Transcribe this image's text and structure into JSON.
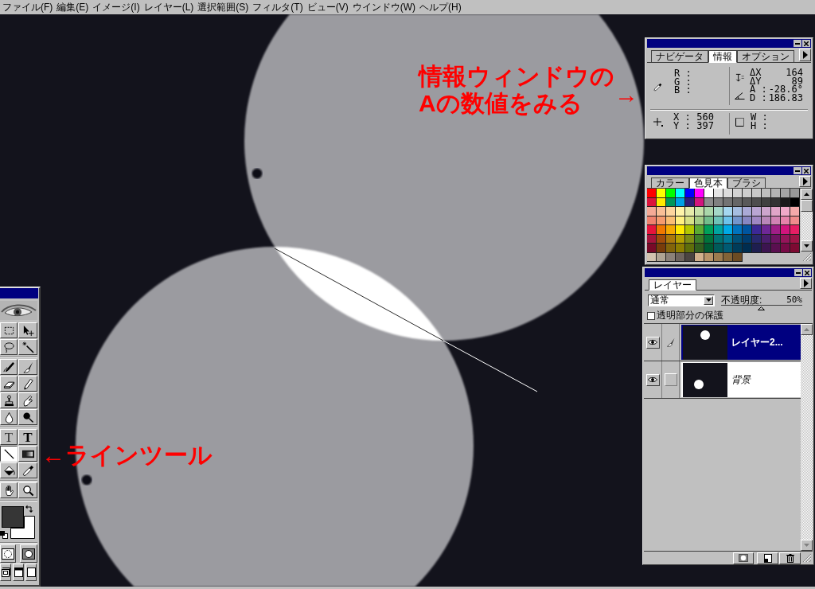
{
  "menu_bar": {
    "items": [
      "ファイル(F)",
      "編集(E)",
      "イメージ(I)",
      "レイヤー(L)",
      "選択範囲(S)",
      "フィルタ(T)",
      "ビュー(V)",
      "ウインドウ(W)",
      "ヘルプ(H)"
    ]
  },
  "canvas": {
    "callouts": [
      {
        "kind": "info",
        "lines": [
          "情報ウィンドウの",
          "Aの数値をみる"
        ],
        "arrow": "→"
      },
      {
        "kind": "tool",
        "lines": [
          "←ラインツール"
        ]
      }
    ]
  },
  "toolbox": {
    "tool_groups": [
      {
        "tools": [
          {
            "kind": "marquee",
            "selected": false
          },
          {
            "kind": "move",
            "selected": false
          },
          {
            "kind": "lasso",
            "selected": false
          },
          {
            "kind": "magic_wand",
            "selected": false
          }
        ]
      },
      {
        "tools": [
          {
            "kind": "airbrush",
            "selected": false
          },
          {
            "kind": "paintbrush",
            "selected": false
          },
          {
            "kind": "eraser",
            "selected": false
          },
          {
            "kind": "pencil",
            "selected": false
          },
          {
            "kind": "rubber_stamp",
            "selected": false
          },
          {
            "kind": "smudge",
            "selected": false
          },
          {
            "kind": "blur",
            "selected": false
          },
          {
            "kind": "dodge",
            "selected": false
          }
        ]
      },
      {
        "tools": [
          {
            "kind": "type_mask",
            "glyph": "T",
            "selected": false
          },
          {
            "kind": "type",
            "glyph": "T",
            "selected": false
          },
          {
            "kind": "line",
            "selected": true
          },
          {
            "kind": "gradient",
            "selected": false
          },
          {
            "kind": "paint_bucket",
            "selected": false
          },
          {
            "kind": "eyedropper",
            "selected": false
          }
        ]
      },
      {
        "tools": [
          {
            "kind": "hand",
            "selected": false
          },
          {
            "kind": "zoom",
            "selected": false
          }
        ]
      }
    ],
    "colors": [
      {
        "kind": "foreground",
        "color": "#363636"
      },
      {
        "kind": "background",
        "color": "#ffffff"
      }
    ]
  },
  "info_panel": {
    "tabs": [
      {
        "label": "ナビゲータ",
        "selected": false
      },
      {
        "label": "情報",
        "selected": true
      },
      {
        "label": "オプション",
        "selected": false
      }
    ],
    "color_readout": [
      "R :",
      "G :",
      "B :"
    ],
    "measure_readout": [
      {
        "label": "ΔX",
        "value": "164"
      },
      {
        "label": "ΔY",
        "value": "89"
      },
      {
        "label": "A :",
        "value": "-28.6°"
      },
      {
        "label": "D :",
        "value": "186.83"
      }
    ],
    "position_readout": [
      {
        "label": "X :",
        "value": "560"
      },
      {
        "label": "Y :",
        "value": "397"
      }
    ],
    "size_readout": [
      "W :",
      "H :"
    ]
  },
  "swatches_panel": {
    "tabs": [
      {
        "label": "カラー",
        "selected": false
      },
      {
        "label": "色見本",
        "selected": true
      },
      {
        "label": "ブラシ",
        "selected": false
      }
    ],
    "swatches": [
      {
        "color": "#ff0000"
      },
      {
        "color": "#ffff00"
      },
      {
        "color": "#00ff00"
      },
      {
        "color": "#00ffff"
      },
      {
        "color": "#0000ff"
      },
      {
        "color": "#ff00ff"
      },
      {
        "color": "#ffffff"
      },
      {
        "color": "#e6e6e6"
      },
      {
        "color": "#dcdcdc"
      },
      {
        "color": "#d2d2d2"
      },
      {
        "color": "#cdcdcd"
      },
      {
        "color": "#c8c8c8"
      },
      {
        "color": "#bebebe"
      },
      {
        "color": "#b4b4b4"
      },
      {
        "color": "#a5a5a5"
      },
      {
        "color": "#999999"
      },
      {
        "color": "#dc143c"
      },
      {
        "color": "#ffea00"
      },
      {
        "color": "#00965a"
      },
      {
        "color": "#00a0e6"
      },
      {
        "color": "#2d1e78"
      },
      {
        "color": "#d2147d"
      },
      {
        "color": "#8c8c8c"
      },
      {
        "color": "#808080"
      },
      {
        "color": "#737373"
      },
      {
        "color": "#666666"
      },
      {
        "color": "#595959"
      },
      {
        "color": "#4d4d4d"
      },
      {
        "color": "#404040"
      },
      {
        "color": "#333333"
      },
      {
        "color": "#1a1a1a"
      },
      {
        "color": "#000000"
      },
      {
        "color": "#f5aa96"
      },
      {
        "color": "#f9bf96"
      },
      {
        "color": "#fdd59e"
      },
      {
        "color": "#fff3aa"
      },
      {
        "color": "#e6ebaa"
      },
      {
        "color": "#c8e1aa"
      },
      {
        "color": "#aad7aa"
      },
      {
        "color": "#a5d7c8"
      },
      {
        "color": "#a5d7f0"
      },
      {
        "color": "#a5bee1"
      },
      {
        "color": "#aaaad7"
      },
      {
        "color": "#b9a5d2"
      },
      {
        "color": "#cda5cd"
      },
      {
        "color": "#e1a5c8"
      },
      {
        "color": "#f0aac8"
      },
      {
        "color": "#f5aaaa"
      },
      {
        "color": "#f0826e"
      },
      {
        "color": "#f59b6e"
      },
      {
        "color": "#fabe73"
      },
      {
        "color": "#fff082"
      },
      {
        "color": "#d7e187"
      },
      {
        "color": "#a5cd87"
      },
      {
        "color": "#73be8c"
      },
      {
        "color": "#6ec3b9"
      },
      {
        "color": "#6ec3eb"
      },
      {
        "color": "#7396cd"
      },
      {
        "color": "#8787c3"
      },
      {
        "color": "#a087c3"
      },
      {
        "color": "#b987b9"
      },
      {
        "color": "#d282b4"
      },
      {
        "color": "#e682aa"
      },
      {
        "color": "#f08c8c"
      },
      {
        "color": "#e6143c"
      },
      {
        "color": "#f07800"
      },
      {
        "color": "#f5aa00"
      },
      {
        "color": "#ffeb00"
      },
      {
        "color": "#b4c800"
      },
      {
        "color": "#5aaa32"
      },
      {
        "color": "#00a05a"
      },
      {
        "color": "#00a5a0"
      },
      {
        "color": "#00aae6"
      },
      {
        "color": "#0073be"
      },
      {
        "color": "#0055a0"
      },
      {
        "color": "#3c2896"
      },
      {
        "color": "#6e2896"
      },
      {
        "color": "#a01e87"
      },
      {
        "color": "#d2147d"
      },
      {
        "color": "#e61e64"
      },
      {
        "color": "#a5143c"
      },
      {
        "color": "#a04b0a"
      },
      {
        "color": "#aa780a"
      },
      {
        "color": "#b4a000"
      },
      {
        "color": "#7d8c14"
      },
      {
        "color": "#3c7d28"
      },
      {
        "color": "#00733c"
      },
      {
        "color": "#007373"
      },
      {
        "color": "#007896"
      },
      {
        "color": "#005078"
      },
      {
        "color": "#003c6e"
      },
      {
        "color": "#28286e"
      },
      {
        "color": "#4b1e6e"
      },
      {
        "color": "#6e1464"
      },
      {
        "color": "#96145a"
      },
      {
        "color": "#a01446"
      },
      {
        "color": "#780a28"
      },
      {
        "color": "#783c0a"
      },
      {
        "color": "#82640a"
      },
      {
        "color": "#8c7d00"
      },
      {
        "color": "#5f6e0a"
      },
      {
        "color": "#325f1e"
      },
      {
        "color": "#005a32"
      },
      {
        "color": "#005a5a"
      },
      {
        "color": "#005a73"
      },
      {
        "color": "#003c5a"
      },
      {
        "color": "#002d50"
      },
      {
        "color": "#1e1e50"
      },
      {
        "color": "#3c1450"
      },
      {
        "color": "#5a0f50"
      },
      {
        "color": "#780a46"
      },
      {
        "color": "#7d0a32"
      },
      {
        "color": "#d2c3af"
      },
      {
        "color": "#b0a594"
      },
      {
        "color": "#8c8279"
      },
      {
        "color": "#6e645d"
      },
      {
        "color": "#4b4441"
      },
      {
        "color": "#d2b08c"
      },
      {
        "color": "#b89469"
      },
      {
        "color": "#9c7b4f"
      },
      {
        "color": "#826337"
      },
      {
        "color": "#6b4b23"
      }
    ]
  },
  "layers_panel": {
    "tabs": [
      {
        "label": "レイヤー",
        "selected": true
      }
    ],
    "blend_mode": {
      "value": "通常"
    },
    "opacity": {
      "label": "不透明度:",
      "value": "50%"
    },
    "preserve_transparency": {
      "label": "透明部分の保護",
      "checked": false
    },
    "layers": [
      {
        "kind": "layer",
        "name": "レイヤー2...",
        "visible": true,
        "selected": true
      },
      {
        "kind": "background",
        "name": "背景",
        "visible": true,
        "selected": false
      }
    ]
  }
}
